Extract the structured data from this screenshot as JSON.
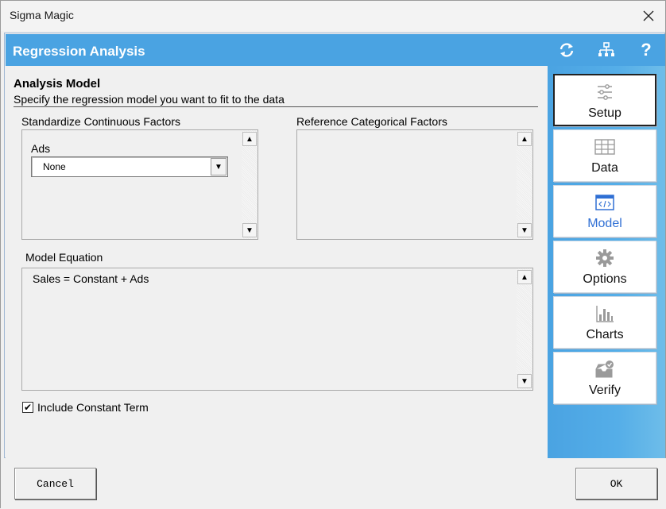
{
  "window": {
    "title": "Sigma Magic"
  },
  "header": {
    "title": "Regression Analysis",
    "icons": [
      "refresh-icon",
      "hierarchy-icon",
      "help-icon"
    ]
  },
  "section": {
    "title": "Analysis Model",
    "subtitle": "Specify the regression model you want to fit to the data"
  },
  "standardize": {
    "label": "Standardize Continuous Factors",
    "factor_label": "Ads",
    "selected": "None"
  },
  "reference": {
    "label": "Reference Categorical Factors"
  },
  "equation": {
    "label": "Model Equation",
    "text": "Sales = Constant + Ads"
  },
  "constant": {
    "label": "Include Constant Term",
    "checked": true,
    "check_glyph": "✔"
  },
  "sidebar": {
    "items": [
      {
        "label": "Setup",
        "icon": "sliders-icon",
        "active": true
      },
      {
        "label": "Data",
        "icon": "table-icon"
      },
      {
        "label": "Model",
        "icon": "code-window-icon",
        "current": true
      },
      {
        "label": "Options",
        "icon": "gear-icon"
      },
      {
        "label": "Charts",
        "icon": "bar-chart-icon"
      },
      {
        "label": "Verify",
        "icon": "inbox-check-icon"
      }
    ]
  },
  "footer": {
    "cancel_label": "Cancel",
    "ok_label": "OK"
  },
  "colors": {
    "accent": "#4aa3e2",
    "model_active": "#2f6fd4"
  }
}
